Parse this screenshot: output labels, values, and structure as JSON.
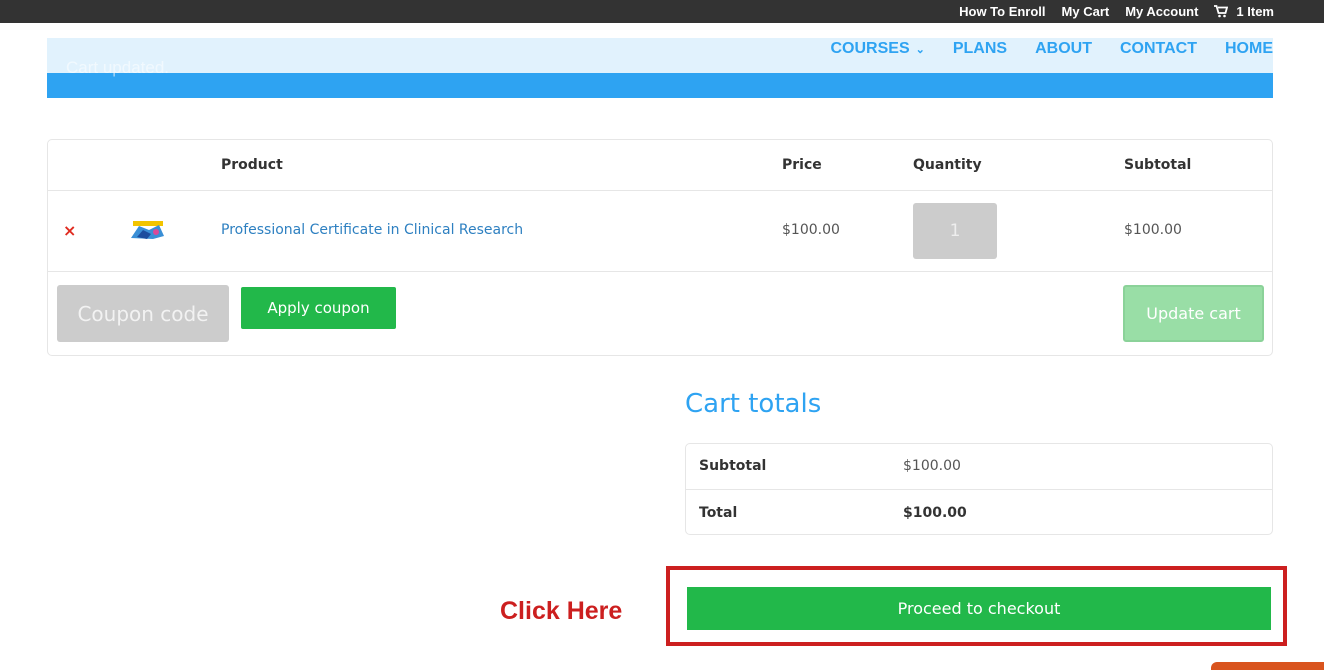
{
  "topbar": {
    "links": [
      "How To Enroll",
      "My Cart",
      "My Account"
    ],
    "cart_label": "1 Item"
  },
  "notice": {
    "text": "Cart updated."
  },
  "nav": {
    "courses": "COURSES",
    "plans": "PLANS",
    "about": "ABOUT",
    "contact": "CONTACT",
    "home": "HOME"
  },
  "cart": {
    "headers": {
      "product": "Product",
      "price": "Price",
      "quantity": "Quantity",
      "subtotal": "Subtotal"
    },
    "item": {
      "remove": "×",
      "name": "Professional Certificate in Clinical Research",
      "price": "$100.00",
      "quantity": "1",
      "subtotal": "$100.00"
    },
    "coupon_placeholder": "Coupon code",
    "apply_label": "Apply coupon",
    "update_label": "Update cart"
  },
  "totals": {
    "title": "Cart totals",
    "subtotal_label": "Subtotal",
    "subtotal_value": "$100.00",
    "total_label": "Total",
    "total_value": "$100.00"
  },
  "annotation": {
    "hint": "Click Here"
  },
  "checkout": {
    "label": "Proceed to checkout"
  },
  "colors": {
    "accent": "#2ea3f2",
    "button_green": "#22b84a",
    "annotation_red": "#cc1f1f"
  }
}
